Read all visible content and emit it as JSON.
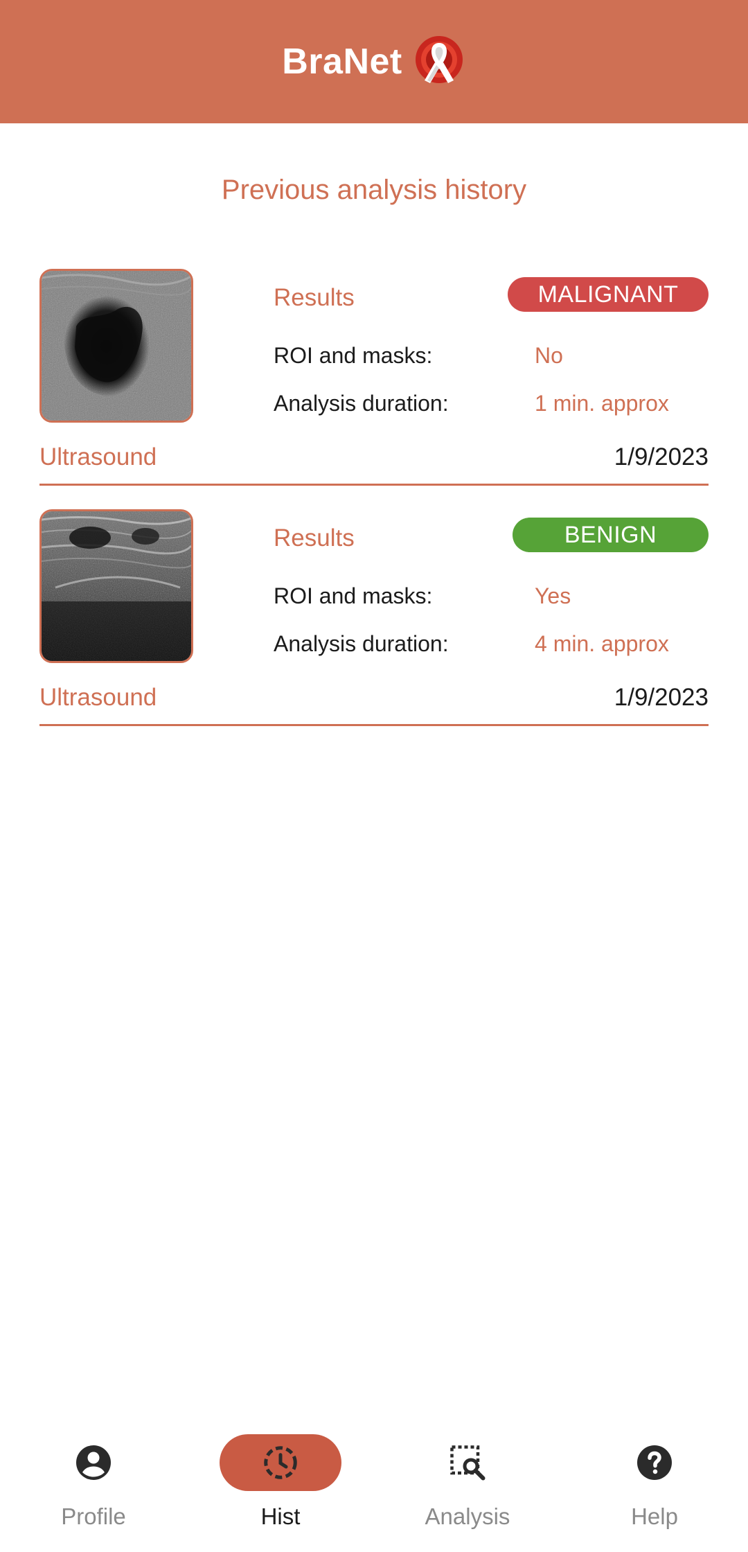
{
  "header": {
    "app_name": "BraNet",
    "logo_icon": "ribbon-logo-icon",
    "color": "#cf7054"
  },
  "page": {
    "title": "Previous analysis history"
  },
  "history": [
    {
      "results_label": "Results",
      "result": "MALIGNANT",
      "result_color": "#d14a49",
      "roi_label": "ROI and masks:",
      "roi_value": "No",
      "duration_label": "Analysis duration:",
      "duration_value": "1 min. approx",
      "modality": "Ultrasound",
      "date": "1/9/2023"
    },
    {
      "results_label": "Results",
      "result": "BENIGN",
      "result_color": "#56a337",
      "roi_label": "ROI and masks:",
      "roi_value": "Yes",
      "duration_label": "Analysis duration:",
      "duration_value": "4 min. approx",
      "modality": "Ultrasound",
      "date": "1/9/2023"
    }
  ],
  "nav": {
    "items": [
      {
        "label": "Profile",
        "icon": "account-circle-icon",
        "active": false
      },
      {
        "label": "Hist",
        "icon": "history-clock-icon",
        "active": true
      },
      {
        "label": "Analysis",
        "icon": "image-search-icon",
        "active": false
      },
      {
        "label": "Help",
        "icon": "help-circle-icon",
        "active": false
      }
    ],
    "active_color": "#c95b44"
  }
}
